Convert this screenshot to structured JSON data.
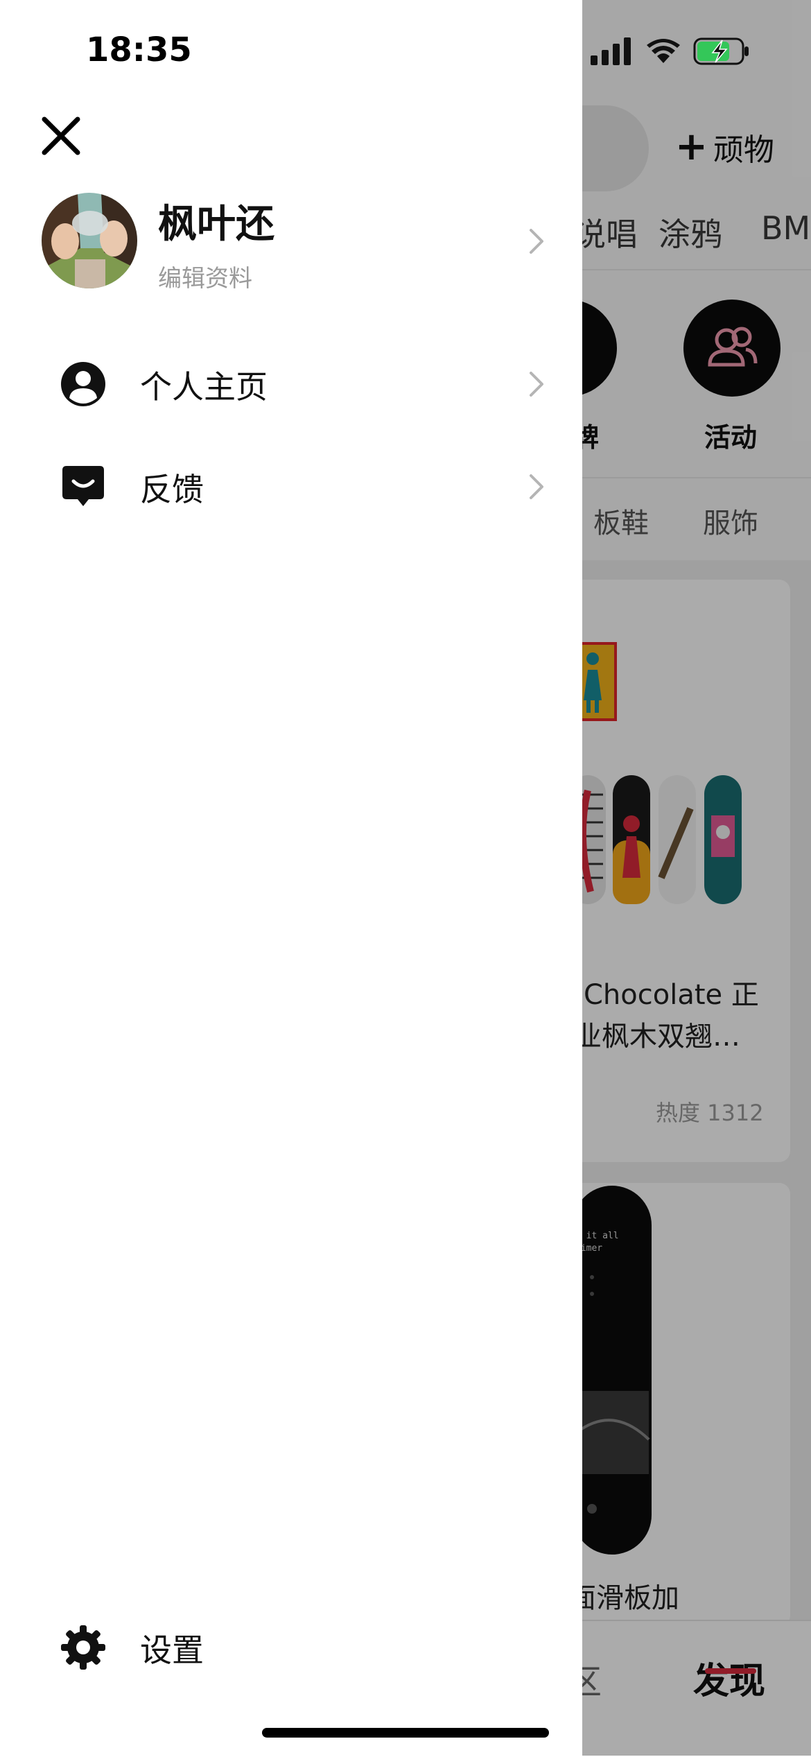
{
  "status_bar": {
    "time": "18:35"
  },
  "drawer": {
    "profile": {
      "name": "枫叶还",
      "edit_label": "编辑资料"
    },
    "menu": [
      {
        "label": "个人主页",
        "icon": "person-circle-icon"
      },
      {
        "label": "反馈",
        "icon": "chat-feedback-icon"
      }
    ],
    "settings_label": "设置"
  },
  "background": {
    "add_button_label": "顽物",
    "category_tabs": [
      "说唱",
      "涂鸦",
      "BM"
    ],
    "shortcut_labels": [
      "牌",
      "活动"
    ],
    "filter_tabs": [
      "板鞋",
      "服饰"
    ],
    "card1": {
      "title_line1": "Chocolate 正",
      "title_line2": "业枫木双翘…",
      "heat": "热度 1312"
    },
    "card2": {
      "deck_text": "n it all\nwimer",
      "title": "板面滑板加"
    },
    "bottom_tabs": [
      "区",
      "发现"
    ]
  },
  "colors": {
    "accent_red": "#d92a3c",
    "scrim": "rgba(0,0,0,0.33)",
    "battery_green": "#34c759"
  }
}
